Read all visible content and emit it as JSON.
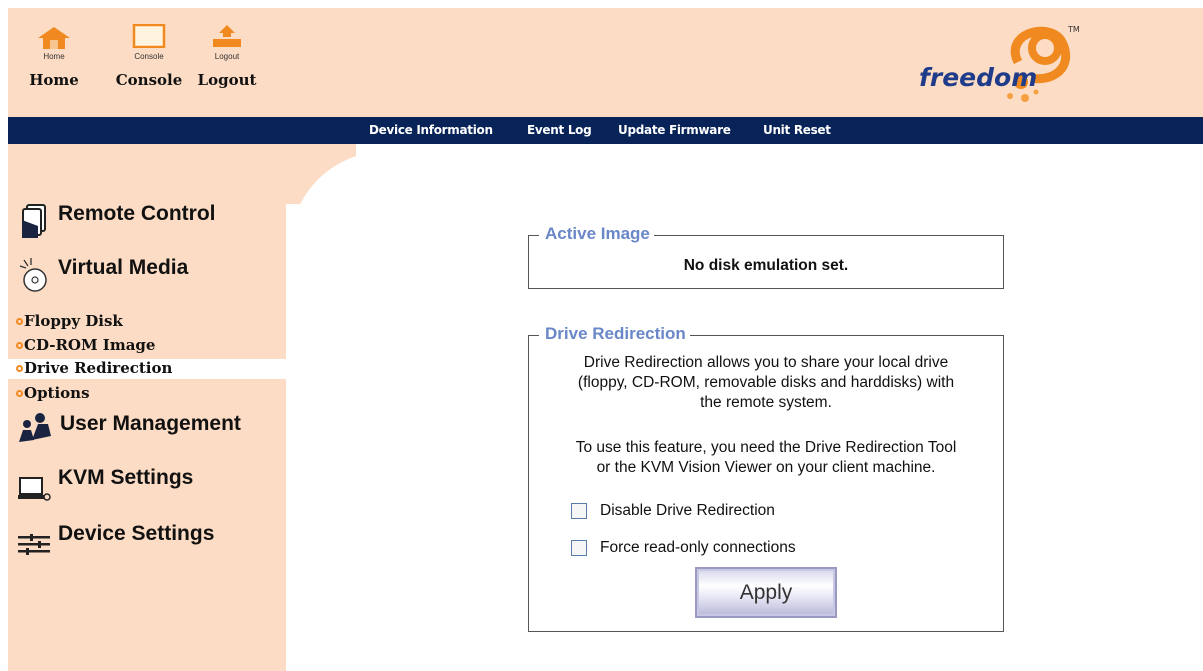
{
  "header": {
    "home": {
      "small": "Home",
      "label": "Home"
    },
    "console": {
      "small": "Console",
      "label": "Console"
    },
    "logout": {
      "small": "Logout",
      "label": "Logout"
    },
    "logo_text": "freedom",
    "logo_tm": "TM"
  },
  "nav": {
    "items": [
      "Device Information",
      "Event Log",
      "Update Firmware",
      "Unit Reset"
    ]
  },
  "sidebar": {
    "remote_control": "Remote Control",
    "virtual_media": "Virtual Media",
    "sub_items": [
      "Floppy Disk",
      "CD-ROM Image",
      "Drive Redirection",
      "Options"
    ],
    "active_sub": "Drive Redirection",
    "user_management": "User Management",
    "kvm_settings": "KVM Settings",
    "device_settings": "Device Settings"
  },
  "active_image": {
    "legend": "Active Image",
    "status": "No disk emulation set."
  },
  "drive_redirection": {
    "legend": "Drive Redirection",
    "desc_lines": [
      "Drive Redirection allows you to share your local drive",
      "(floppy, CD-ROM, removable disks and harddisks) with",
      "the remote system."
    ],
    "tool_lines": [
      "To use this feature, you need the Drive Redirection Tool",
      "or the KVM Vision Viewer on your client machine."
    ],
    "disable_label": "Disable Drive Redirection",
    "readonly_label": "Force read-only connections",
    "apply_label": "Apply"
  },
  "colors": {
    "peach": "#fcdcc4",
    "navy": "#082358",
    "legend_blue": "#6a87c8",
    "orange": "#f08a20"
  }
}
